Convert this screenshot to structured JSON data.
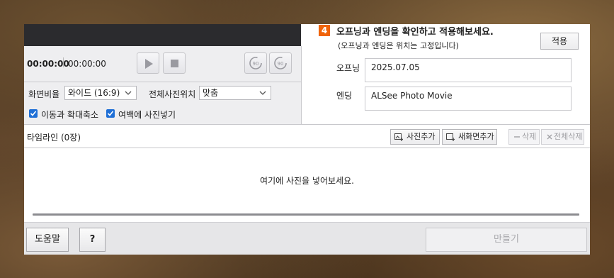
{
  "player": {
    "current_time": "00:00:00",
    "total_time": "00:00:00",
    "rotate_left_label": "90",
    "rotate_right_label": "90"
  },
  "options": {
    "aspect_label": "화면비율",
    "aspect_value": "와이드 (16:9)",
    "position_label": "전체사진위치",
    "position_value": "맞춤",
    "pan_zoom_label": "이동과 확대축소",
    "fill_margin_label": "여백에 사진넣기",
    "pan_zoom_checked": true,
    "fill_margin_checked": true
  },
  "opening_ending": {
    "step_number": "4",
    "title": "오프닝과 엔딩을 확인하고 적용해보세요.",
    "subtitle": "(오프닝과 엔딩은 위치는 고정입니다)",
    "apply_label": "적용",
    "opening_label": "오프닝",
    "opening_value": "2025.07.05",
    "ending_label": "엔딩",
    "ending_value": "ALSee Photo Movie"
  },
  "timeline": {
    "title": "타임라인 (0장)",
    "add_photo_label": "사진추가",
    "new_screen_label": "새화면추가",
    "delete_label": "삭제",
    "delete_all_label": "전체삭제",
    "empty_message": "여기에 사진을 넣어보세요."
  },
  "bottom": {
    "help_label": "도움말",
    "question_label": "?",
    "make_label": "만들기"
  },
  "colors": {
    "accent": "#f0640a",
    "checkbox": "#1f6fd6",
    "preview_bg": "#2b2b2e"
  }
}
